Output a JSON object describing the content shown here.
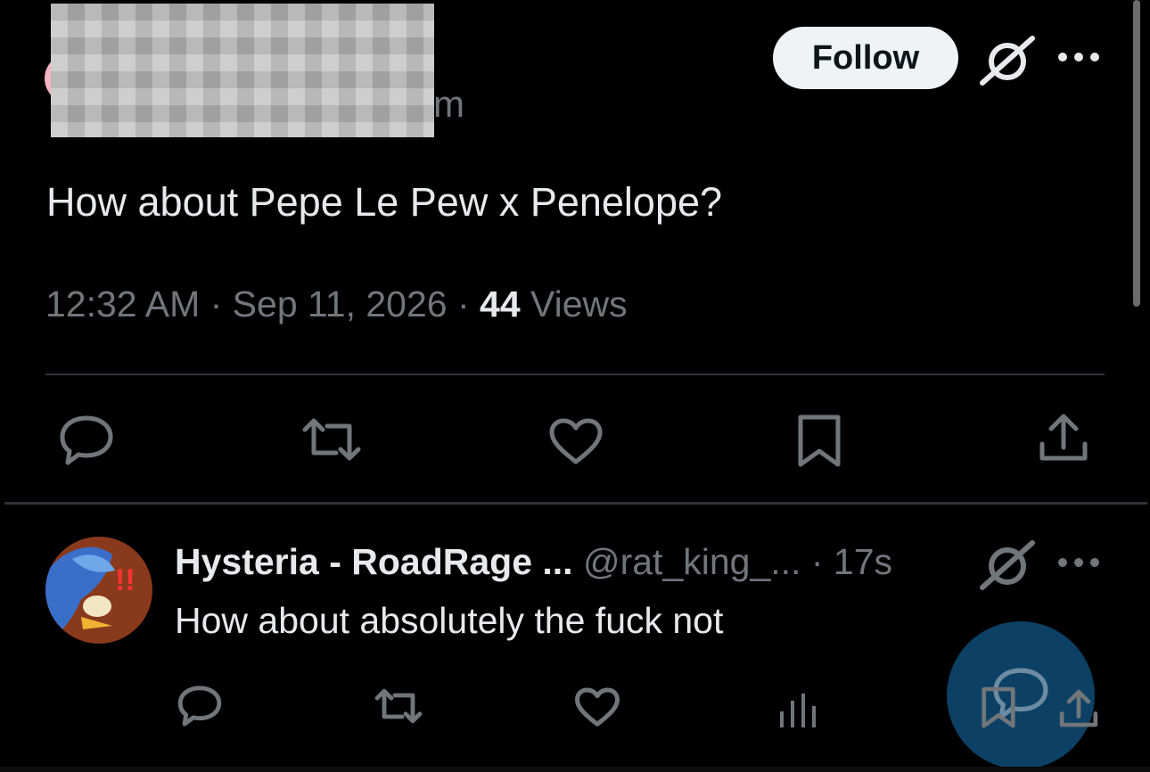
{
  "header": {
    "handle_tail": "m",
    "follow_label": "Follow",
    "icons": {
      "grok": "grok-slash-icon",
      "more": "more-dots-icon"
    }
  },
  "tweet": {
    "text": "How about Pepe Le Pew x Penelope?",
    "time": "12:32 AM",
    "dot1": " · ",
    "date": "Sep 11, 2026",
    "dot2": " · ",
    "views_count": "44",
    "views_label": " Views",
    "actions": [
      "reply-icon",
      "repost-icon",
      "like-icon",
      "bookmark-icon",
      "share-icon"
    ]
  },
  "reply": {
    "name": "Hysteria - RoadRage ...",
    "handle": "@rat_king_...",
    "separator": " · ",
    "time": "17s",
    "text": "How about absolutely the fuck not",
    "actions": [
      "reply-icon",
      "repost-icon",
      "like-icon",
      "views-icon",
      "bookmark-icon",
      "share-icon"
    ]
  },
  "colors": {
    "background": "#000000",
    "text_primary": "#e7e9ea",
    "text_secondary": "#71767b",
    "divider": "#2f3336",
    "follow_bg": "#eff3f4",
    "fab": "#1d9bf0"
  }
}
